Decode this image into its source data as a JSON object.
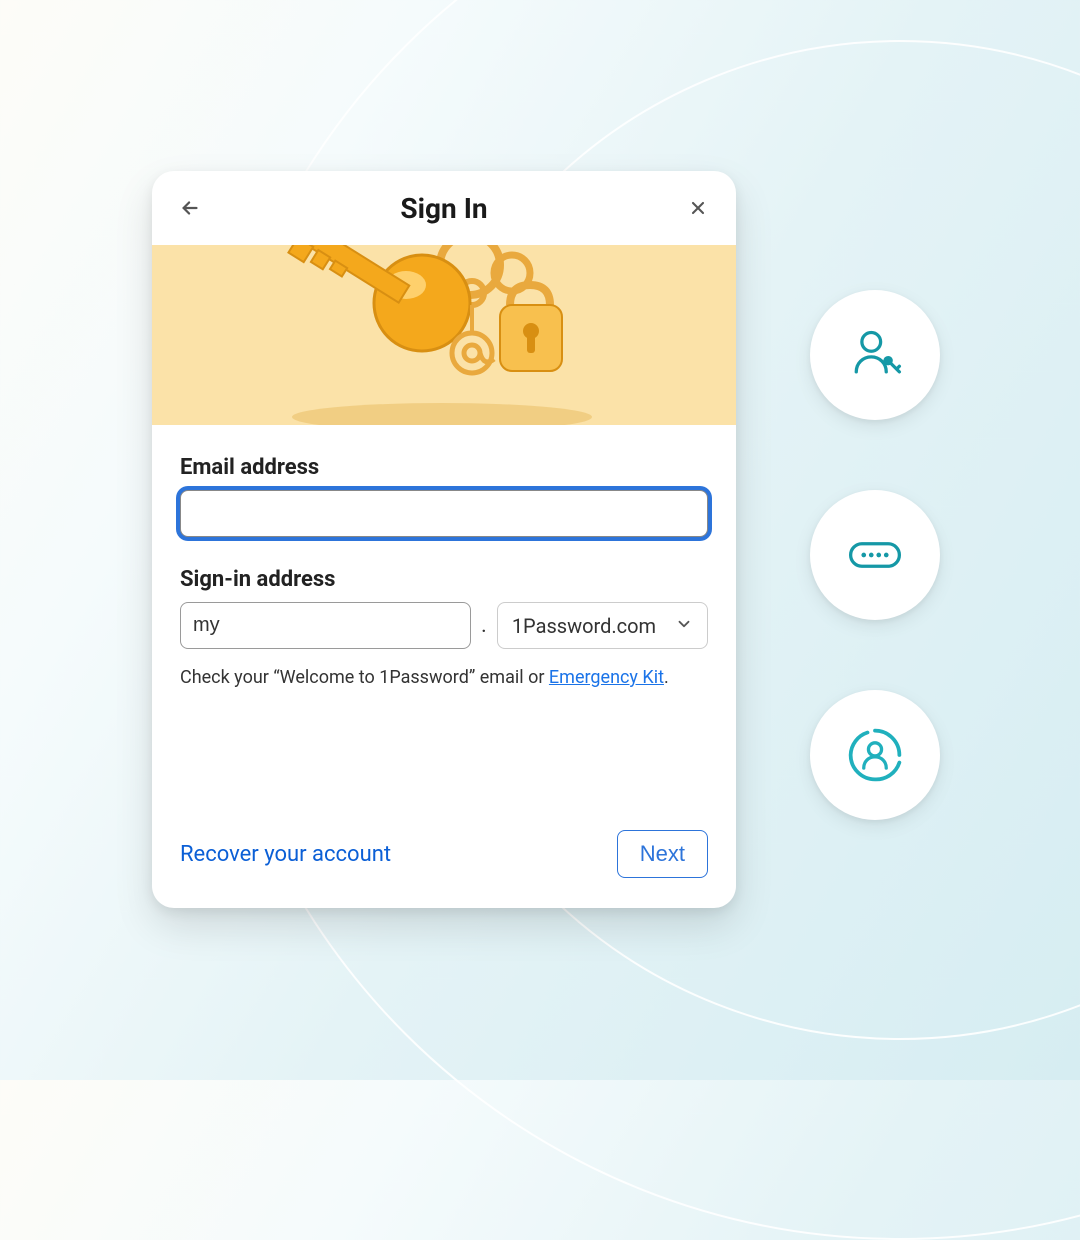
{
  "header": {
    "title": "Sign In",
    "back_icon": "arrow-left",
    "close_icon": "x"
  },
  "form": {
    "email_label": "Email address",
    "email_value": "",
    "signin_label": "Sign-in address",
    "subdomain_value": "my",
    "domain_selected": "1Password.com",
    "hint_prefix": "Check your “Welcome to 1Password” email or ",
    "hint_link": "Emergency Kit",
    "hint_suffix": "."
  },
  "footer": {
    "recover_label": "Recover your account",
    "next_label": "Next"
  },
  "side_icons": [
    {
      "name": "user-key-icon"
    },
    {
      "name": "password-dots-icon"
    },
    {
      "name": "profile-progress-icon"
    }
  ],
  "colors": {
    "accent_blue": "#2d74da",
    "teal": "#1598a6",
    "illustration_bg": "#fbe2a8",
    "key_gold": "#f4a81c"
  }
}
